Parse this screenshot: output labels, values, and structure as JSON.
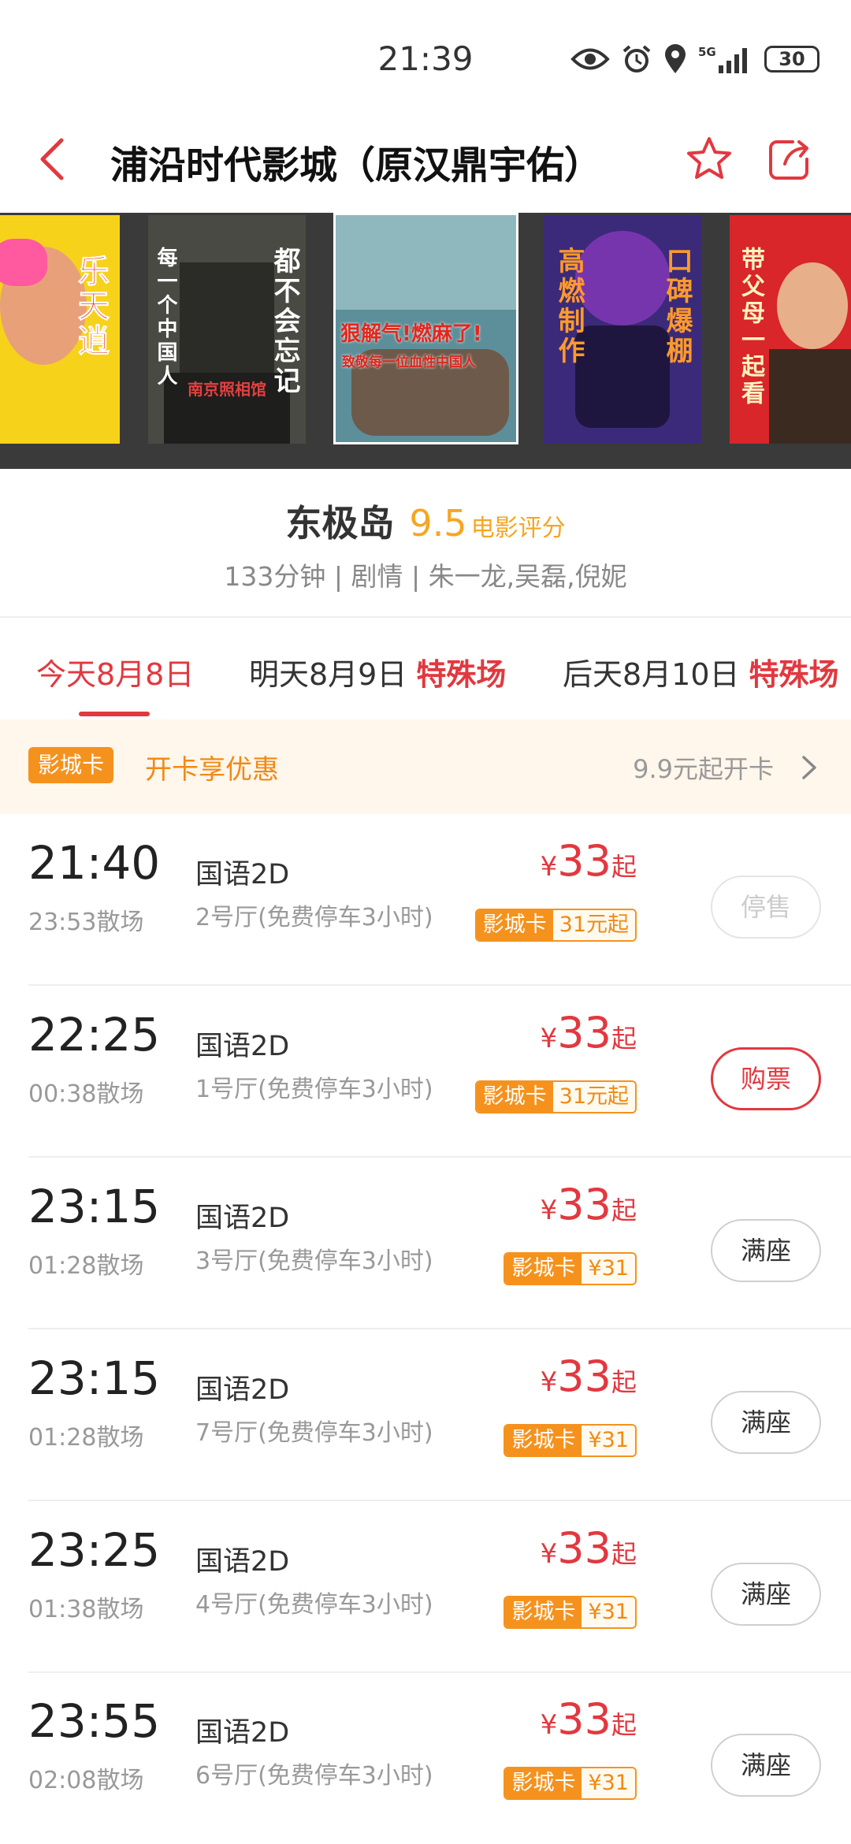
{
  "status_bar": {
    "time": "21:39",
    "network": "5G",
    "battery": "30"
  },
  "header": {
    "title": "浦沿时代影城（原汉鼎宇佑）"
  },
  "posters": [
    {
      "text": "乐天逍",
      "bg": "#f7d21b"
    },
    {
      "text_left": "每一个中国人",
      "text_right": "都不会忘记",
      "caption": "南京照相馆",
      "bg": "#4a4a44"
    },
    {
      "headline": "狠解气!燃麻了!",
      "tagline": "致敬每一位血性中国人",
      "bg": "#5d8f9a"
    },
    {
      "text_left": "高燃制作",
      "text_right": "口碑爆棚",
      "bg": "#3b2a7a"
    },
    {
      "text": "带父母一起看",
      "bg": "#d8262a"
    }
  ],
  "movie": {
    "name": "东极岛",
    "score": "9.5",
    "score_label": "电影评分",
    "meta": "133分钟 | 剧情 | 朱一龙,吴磊,倪妮"
  },
  "date_tabs": [
    {
      "label": "今天8月8日",
      "special": ""
    },
    {
      "label": "明天8月9日",
      "special": "特殊场"
    },
    {
      "label": "后天8月10日",
      "special": "特殊场"
    }
  ],
  "card_banner": {
    "badge": "影城卡",
    "promo": "开卡享优惠",
    "price_text": "9.9元起开卡"
  },
  "sessions": [
    {
      "start": "21:40",
      "end": "23:53散场",
      "lang": "国语2D",
      "hall": "2号厅(免费停车3小时)",
      "yen": "¥",
      "price": "33",
      "qi": "起",
      "card_tag": "影城卡",
      "card_price": "31元起",
      "action": "停售",
      "state": "disabled"
    },
    {
      "start": "22:25",
      "end": "00:38散场",
      "lang": "国语2D",
      "hall": "1号厅(免费停车3小时)",
      "yen": "¥",
      "price": "33",
      "qi": "起",
      "card_tag": "影城卡",
      "card_price": "31元起",
      "action": "购票",
      "state": "buy"
    },
    {
      "start": "23:15",
      "end": "01:28散场",
      "lang": "国语2D",
      "hall": "3号厅(免费停车3小时)",
      "yen": "¥",
      "price": "33",
      "qi": "起",
      "card_tag": "影城卡",
      "card_price": "¥31",
      "action": "满座",
      "state": "full"
    },
    {
      "start": "23:15",
      "end": "01:28散场",
      "lang": "国语2D",
      "hall": "7号厅(免费停车3小时)",
      "yen": "¥",
      "price": "33",
      "qi": "起",
      "card_tag": "影城卡",
      "card_price": "¥31",
      "action": "满座",
      "state": "full"
    },
    {
      "start": "23:25",
      "end": "01:38散场",
      "lang": "国语2D",
      "hall": "4号厅(免费停车3小时)",
      "yen": "¥",
      "price": "33",
      "qi": "起",
      "card_tag": "影城卡",
      "card_price": "¥31",
      "action": "满座",
      "state": "full"
    },
    {
      "start": "23:55",
      "end": "02:08散场",
      "lang": "国语2D",
      "hall": "6号厅(免费停车3小时)",
      "yen": "¥",
      "price": "33",
      "qi": "起",
      "card_tag": "影城卡",
      "card_price": "¥31",
      "action": "满座",
      "state": "full"
    }
  ],
  "colors": {
    "accent": "#e2383f",
    "card_orange": "#f5921e",
    "score": "#f5a623"
  }
}
